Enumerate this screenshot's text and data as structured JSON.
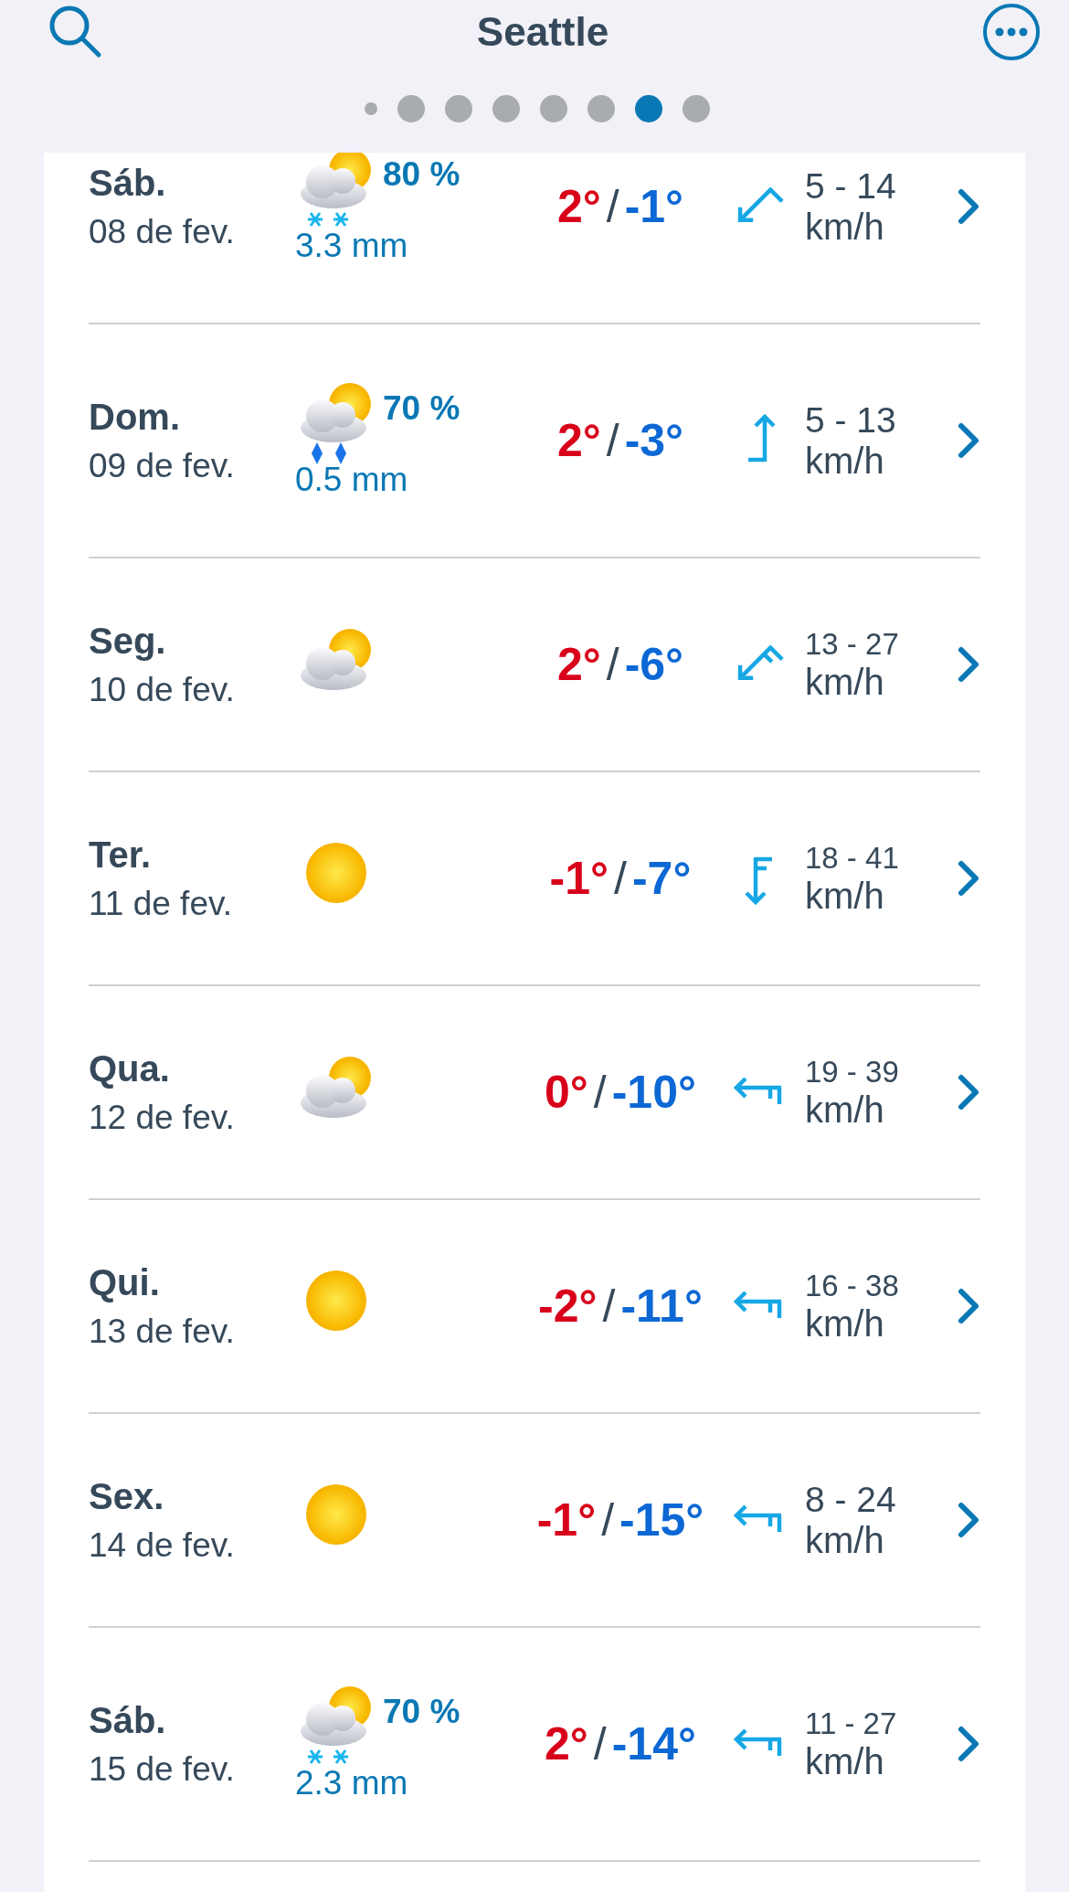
{
  "header": {
    "title": "Seattle"
  },
  "page_dots": [
    {
      "kind": "location",
      "selected": false
    },
    {
      "kind": "page",
      "selected": false
    },
    {
      "kind": "page",
      "selected": false
    },
    {
      "kind": "page",
      "selected": false
    },
    {
      "kind": "page",
      "selected": false
    },
    {
      "kind": "page",
      "selected": false
    },
    {
      "kind": "page",
      "selected": true
    },
    {
      "kind": "page",
      "selected": false
    }
  ],
  "days": [
    {
      "day": "Sáb.",
      "date": "08 de fev.",
      "weather": {
        "kind": "snow",
        "chance": "80 %",
        "amount": "3.3 mm"
      },
      "high": "2°",
      "separator": "/",
      "low": "-1°",
      "wind": {
        "kind": "southwest",
        "speed": "5 - 14",
        "unit": "km/h"
      }
    },
    {
      "day": "Dom.",
      "date": "09 de fev.",
      "weather": {
        "kind": "rain",
        "chance": "70 %",
        "amount": "0.5 mm"
      },
      "high": "2°",
      "separator": "/",
      "low": "-3°",
      "wind": {
        "kind": "north",
        "speed": "5 - 13",
        "unit": "km/h"
      }
    },
    {
      "day": "Seg.",
      "date": "10 de fev.",
      "weather": {
        "kind": "cloudy"
      },
      "high": "2°",
      "separator": "/",
      "low": "-6°",
      "wind": {
        "kind": "southwest2",
        "speed": "13 - 27",
        "unit": "km/h"
      }
    },
    {
      "day": "Ter.",
      "date": "11 de fev.",
      "weather": {
        "kind": "sun"
      },
      "high": "-1°",
      "separator": "/",
      "low": "-7°",
      "wind": {
        "kind": "south2",
        "speed": "18 - 41",
        "unit": "km/h"
      }
    },
    {
      "day": "Qua.",
      "date": "12 de fev.",
      "weather": {
        "kind": "cloudy"
      },
      "high": "0°",
      "separator": "/",
      "low": "-10°",
      "wind": {
        "kind": "west2",
        "speed": "19 - 39",
        "unit": "km/h"
      }
    },
    {
      "day": "Qui.",
      "date": "13 de fev.",
      "weather": {
        "kind": "sun"
      },
      "high": "-2°",
      "separator": "/",
      "low": "-11°",
      "wind": {
        "kind": "west2",
        "speed": "16 - 38",
        "unit": "km/h"
      }
    },
    {
      "day": "Sex.",
      "date": "14 de fev.",
      "weather": {
        "kind": "sun"
      },
      "high": "-1°",
      "separator": "/",
      "low": "-15°",
      "wind": {
        "kind": "west2",
        "speed": "8 - 24",
        "unit": "km/h"
      }
    },
    {
      "day": "Sáb.",
      "date": "15 de fev.",
      "weather": {
        "kind": "snow",
        "chance": "70 %",
        "amount": "2.3 mm"
      },
      "high": "2°",
      "separator": "/",
      "low": "-14°",
      "wind": {
        "kind": "west2",
        "speed": "11 - 27",
        "unit": "km/h"
      }
    }
  ]
}
